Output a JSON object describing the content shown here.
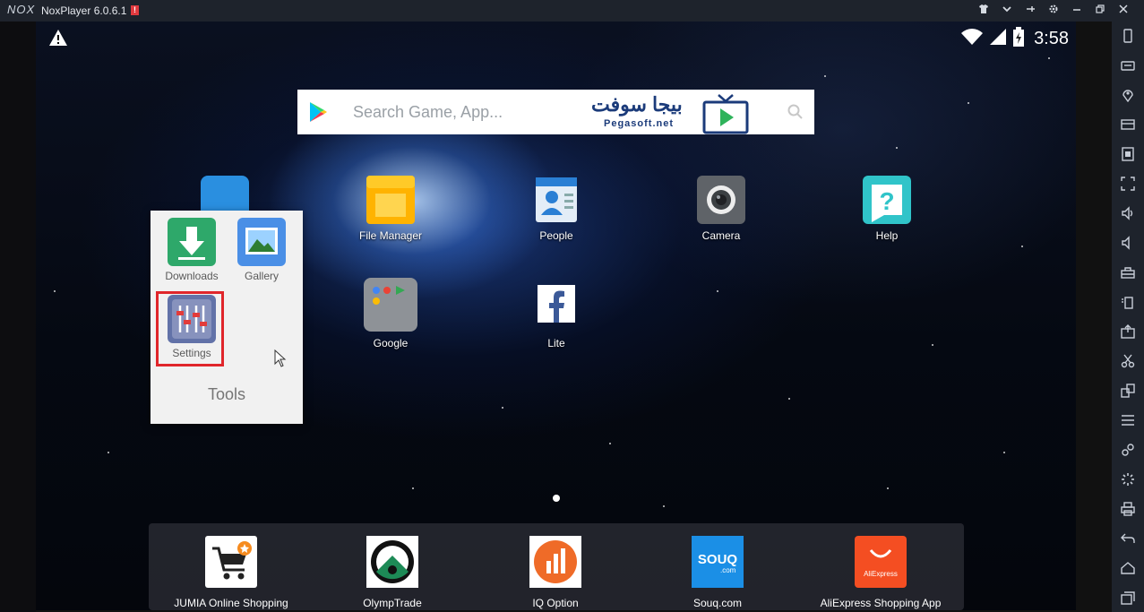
{
  "window": {
    "logo_text": "NOX",
    "title": "NoxPlayer 6.0.6.1",
    "badge": "!",
    "controls": [
      "shirt-icon",
      "chevron-down-icon",
      "pin-icon",
      "gear-icon",
      "minimize-icon",
      "restore-icon",
      "close-icon"
    ]
  },
  "status_bar": {
    "time": "3:58",
    "icons": [
      "warning-icon",
      "wifi-icon",
      "signal-icon",
      "battery-icon"
    ]
  },
  "search": {
    "placeholder": "Search Game, App...",
    "watermark_ar": "بيجا سوفت",
    "watermark_en": "Pegasoft.net"
  },
  "desktop_apps": [
    {
      "label": "File Manager",
      "icon": "folder-icon"
    },
    {
      "label": "People",
      "icon": "contacts-icon"
    },
    {
      "label": "Camera",
      "icon": "camera-icon"
    },
    {
      "label": "Help",
      "icon": "help-icon"
    },
    {
      "label": "Google",
      "icon": "google-folder-icon"
    },
    {
      "label": "Lite",
      "icon": "facebook-icon"
    }
  ],
  "folder": {
    "title": "Tools",
    "items": [
      {
        "label": "Downloads",
        "icon": "download-icon"
      },
      {
        "label": "Gallery",
        "icon": "gallery-icon"
      },
      {
        "label": "Settings",
        "icon": "settings-sliders-icon"
      }
    ]
  },
  "dock": [
    {
      "label": "JUMIA Online Shopping",
      "icon": "cart-icon"
    },
    {
      "label": "OlympTrade",
      "icon": "olymptrade-icon"
    },
    {
      "label": "IQ Option",
      "icon": "iqoption-icon"
    },
    {
      "label": "Souq.com",
      "icon": "souq-icon",
      "icon_text": "SOUQ",
      "icon_sub": ".com"
    },
    {
      "label": "AliExpress Shopping App",
      "icon": "aliexpress-icon",
      "icon_text": "AliExpress"
    }
  ],
  "sidebar_tools": [
    "phone-icon",
    "keyboard-icon",
    "location-icon",
    "screen-icon",
    "apk-icon",
    "fullscreen-icon",
    "volume-up-icon",
    "volume-down-icon",
    "toolbox-icon",
    "shake-icon",
    "screenshot-icon",
    "scissors-icon",
    "multi-instance-icon",
    "menu-icon",
    "link-icon",
    "loading-icon",
    "print-icon",
    "back-icon",
    "home-icon",
    "recent-apps-icon"
  ],
  "colors": {
    "titlebar": "#1e232c",
    "highlight": "#e0262b",
    "folder_bg": "#f1f1f1"
  }
}
